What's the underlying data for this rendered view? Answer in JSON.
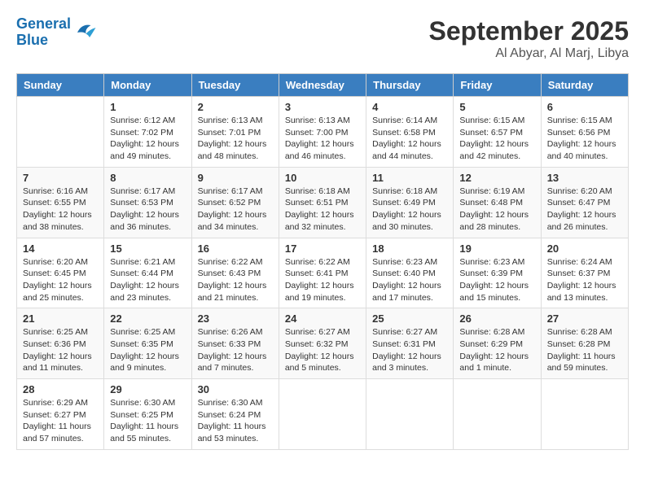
{
  "logo": {
    "line1": "General",
    "line2": "Blue"
  },
  "title": "September 2025",
  "location": "Al Abyar, Al Marj, Libya",
  "days_of_week": [
    "Sunday",
    "Monday",
    "Tuesday",
    "Wednesday",
    "Thursday",
    "Friday",
    "Saturday"
  ],
  "weeks": [
    [
      {
        "day": "",
        "info": ""
      },
      {
        "day": "1",
        "info": "Sunrise: 6:12 AM\nSunset: 7:02 PM\nDaylight: 12 hours\nand 49 minutes."
      },
      {
        "day": "2",
        "info": "Sunrise: 6:13 AM\nSunset: 7:01 PM\nDaylight: 12 hours\nand 48 minutes."
      },
      {
        "day": "3",
        "info": "Sunrise: 6:13 AM\nSunset: 7:00 PM\nDaylight: 12 hours\nand 46 minutes."
      },
      {
        "day": "4",
        "info": "Sunrise: 6:14 AM\nSunset: 6:58 PM\nDaylight: 12 hours\nand 44 minutes."
      },
      {
        "day": "5",
        "info": "Sunrise: 6:15 AM\nSunset: 6:57 PM\nDaylight: 12 hours\nand 42 minutes."
      },
      {
        "day": "6",
        "info": "Sunrise: 6:15 AM\nSunset: 6:56 PM\nDaylight: 12 hours\nand 40 minutes."
      }
    ],
    [
      {
        "day": "7",
        "info": "Sunrise: 6:16 AM\nSunset: 6:55 PM\nDaylight: 12 hours\nand 38 minutes."
      },
      {
        "day": "8",
        "info": "Sunrise: 6:17 AM\nSunset: 6:53 PM\nDaylight: 12 hours\nand 36 minutes."
      },
      {
        "day": "9",
        "info": "Sunrise: 6:17 AM\nSunset: 6:52 PM\nDaylight: 12 hours\nand 34 minutes."
      },
      {
        "day": "10",
        "info": "Sunrise: 6:18 AM\nSunset: 6:51 PM\nDaylight: 12 hours\nand 32 minutes."
      },
      {
        "day": "11",
        "info": "Sunrise: 6:18 AM\nSunset: 6:49 PM\nDaylight: 12 hours\nand 30 minutes."
      },
      {
        "day": "12",
        "info": "Sunrise: 6:19 AM\nSunset: 6:48 PM\nDaylight: 12 hours\nand 28 minutes."
      },
      {
        "day": "13",
        "info": "Sunrise: 6:20 AM\nSunset: 6:47 PM\nDaylight: 12 hours\nand 26 minutes."
      }
    ],
    [
      {
        "day": "14",
        "info": "Sunrise: 6:20 AM\nSunset: 6:45 PM\nDaylight: 12 hours\nand 25 minutes."
      },
      {
        "day": "15",
        "info": "Sunrise: 6:21 AM\nSunset: 6:44 PM\nDaylight: 12 hours\nand 23 minutes."
      },
      {
        "day": "16",
        "info": "Sunrise: 6:22 AM\nSunset: 6:43 PM\nDaylight: 12 hours\nand 21 minutes."
      },
      {
        "day": "17",
        "info": "Sunrise: 6:22 AM\nSunset: 6:41 PM\nDaylight: 12 hours\nand 19 minutes."
      },
      {
        "day": "18",
        "info": "Sunrise: 6:23 AM\nSunset: 6:40 PM\nDaylight: 12 hours\nand 17 minutes."
      },
      {
        "day": "19",
        "info": "Sunrise: 6:23 AM\nSunset: 6:39 PM\nDaylight: 12 hours\nand 15 minutes."
      },
      {
        "day": "20",
        "info": "Sunrise: 6:24 AM\nSunset: 6:37 PM\nDaylight: 12 hours\nand 13 minutes."
      }
    ],
    [
      {
        "day": "21",
        "info": "Sunrise: 6:25 AM\nSunset: 6:36 PM\nDaylight: 12 hours\nand 11 minutes."
      },
      {
        "day": "22",
        "info": "Sunrise: 6:25 AM\nSunset: 6:35 PM\nDaylight: 12 hours\nand 9 minutes."
      },
      {
        "day": "23",
        "info": "Sunrise: 6:26 AM\nSunset: 6:33 PM\nDaylight: 12 hours\nand 7 minutes."
      },
      {
        "day": "24",
        "info": "Sunrise: 6:27 AM\nSunset: 6:32 PM\nDaylight: 12 hours\nand 5 minutes."
      },
      {
        "day": "25",
        "info": "Sunrise: 6:27 AM\nSunset: 6:31 PM\nDaylight: 12 hours\nand 3 minutes."
      },
      {
        "day": "26",
        "info": "Sunrise: 6:28 AM\nSunset: 6:29 PM\nDaylight: 12 hours\nand 1 minute."
      },
      {
        "day": "27",
        "info": "Sunrise: 6:28 AM\nSunset: 6:28 PM\nDaylight: 11 hours\nand 59 minutes."
      }
    ],
    [
      {
        "day": "28",
        "info": "Sunrise: 6:29 AM\nSunset: 6:27 PM\nDaylight: 11 hours\nand 57 minutes."
      },
      {
        "day": "29",
        "info": "Sunrise: 6:30 AM\nSunset: 6:25 PM\nDaylight: 11 hours\nand 55 minutes."
      },
      {
        "day": "30",
        "info": "Sunrise: 6:30 AM\nSunset: 6:24 PM\nDaylight: 11 hours\nand 53 minutes."
      },
      {
        "day": "",
        "info": ""
      },
      {
        "day": "",
        "info": ""
      },
      {
        "day": "",
        "info": ""
      },
      {
        "day": "",
        "info": ""
      }
    ]
  ]
}
